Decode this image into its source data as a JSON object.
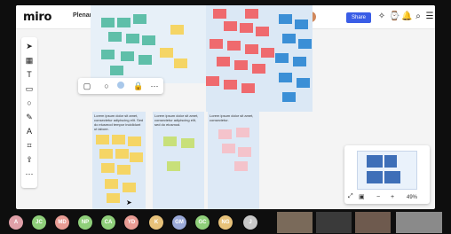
{
  "app": {
    "logo": "miro",
    "board_title": "Plenary Debate FINAL"
  },
  "header": {
    "share_label": "Share",
    "share_color": "#3a5de6",
    "icons": [
      "upload-icon",
      "undo-icon",
      "redo-icon",
      "cursor-icon",
      "reactions-icon",
      "timer-icon",
      "notifications-icon",
      "search-icon",
      "menu-icon"
    ]
  },
  "toolbar": {
    "tools": [
      "select-icon",
      "template-icon",
      "text-icon",
      "sticky-note-icon",
      "shape-icon",
      "pen-icon",
      "comment-icon",
      "frame-icon",
      "upload-icon",
      "more-icon"
    ]
  },
  "context_toolbar": {
    "icons": [
      "frame-icon",
      "shape-icon",
      "color-icon",
      "lock-icon",
      "more-icon"
    ]
  },
  "columns": [
    {
      "heading": "Lorem ipsum dolor sit amet, consectetur adipiscing elit. Sed do eiusmod tempor incididunt ut labore."
    },
    {
      "heading": "Lorem ipsum dolor sit amet, consectetur adipiscing elit, sed do eiusmod."
    },
    {
      "heading": "Lorem ipsum dolor sit amet, consectetur."
    }
  ],
  "minimap": {
    "zoom_label": "49%"
  },
  "participants": [
    {
      "initials": "A",
      "color": "#e0a0a8"
    },
    {
      "initials": "JC",
      "color": "#8fcf7a"
    },
    {
      "initials": "MD",
      "color": "#e89c94"
    },
    {
      "initials": "NP",
      "color": "#8fcf7a"
    },
    {
      "initials": "CA",
      "color": "#8fcf7a"
    },
    {
      "initials": "YD",
      "color": "#e89c94"
    },
    {
      "initials": "K",
      "color": "#e8c27a"
    },
    {
      "initials": "GM",
      "color": "#9aa9d8"
    },
    {
      "initials": "GC",
      "color": "#8fcf7a"
    },
    {
      "initials": "NG",
      "color": "#e8c27a"
    },
    {
      "initials": "J",
      "color": "#c8c8c8"
    }
  ]
}
